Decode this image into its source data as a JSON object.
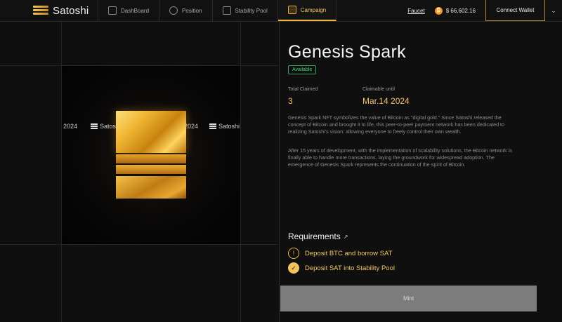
{
  "brand": {
    "name": "Satoshi"
  },
  "nav": {
    "tabs": [
      {
        "label": "DashBoard",
        "icon": "dashboard-icon",
        "active": false
      },
      {
        "label": "Position",
        "icon": "position-icon",
        "active": false
      },
      {
        "label": "Stability Pool",
        "icon": "stability-pool-icon",
        "active": false
      },
      {
        "label": "Campaign",
        "icon": "campaign-icon",
        "active": true
      }
    ],
    "faucet_label": "Faucet",
    "btc_price": "$ 66,602.16",
    "connect_label": "Connect Wallet",
    "menu_icon": "chevron-down-icon"
  },
  "art": {
    "marquee_left_year": "2024",
    "marquee_left_brand": "Satoshi",
    "marquee_right_year": "2024",
    "marquee_right_brand": "Satoshi"
  },
  "campaign": {
    "title": "Genesis Spark",
    "status": "Available",
    "total_claimed_label": "Total Claimed",
    "total_claimed_value": "3",
    "claimable_label": "Claimable until",
    "claimable_value": "Mar.14 2024",
    "description_1": "Genesis Spark NFT symbolizes the value of Bitcoin as \"digital gold.\" Since Satoshi released the concept of Bitcoin and brought it to life, this peer-to-peer payment network has been dedicated to realizing Satoshi's vision: allowing everyone to freely control their own wealth.",
    "description_2": "After 15 years of development, with the implementation of scalability solutions, the Bitcoin network is finally able to handle more transactions, laying the groundwork for widespread adoption. The emergence of Genesis Spark represents the continuation of the spirit of Bitcoin.",
    "requirements_title": "Requirements",
    "requirements": [
      {
        "label": "Deposit BTC and borrow SAT",
        "status": "pending",
        "icon_text": "!"
      },
      {
        "label": "Deposit SAT into Stability Pool",
        "status": "done",
        "icon_text": "✓"
      }
    ],
    "mint_label": "Mint"
  },
  "colors": {
    "accent": "#f0b63d",
    "available": "#4bd17a",
    "mint_bg": "#7c7c7c"
  }
}
